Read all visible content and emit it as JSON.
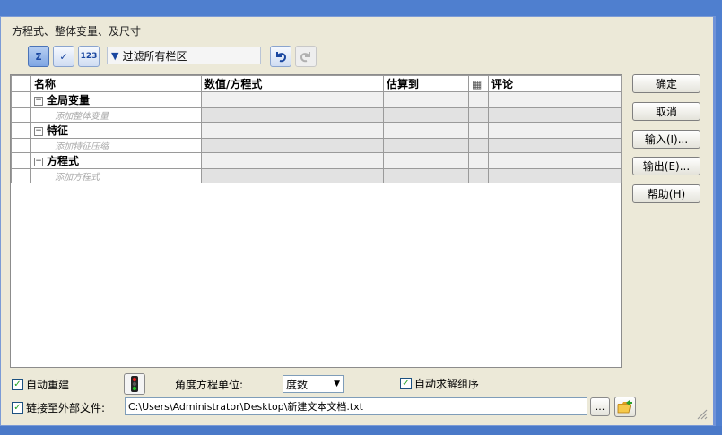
{
  "window": {
    "title": "方程式、整体变量、及尺寸"
  },
  "toolbar": {
    "filter_text": "过滤所有栏区",
    "buttons": [
      {
        "icon": "sigma-filter-icon",
        "state": "active"
      },
      {
        "icon": "check-filter-icon"
      },
      {
        "icon": "number-filter-icon",
        "label": "123"
      }
    ]
  },
  "grid": {
    "headers": {
      "name": "名称",
      "value": "数值/方程式",
      "evaluates": "估算到",
      "comment": "评论"
    },
    "groups": [
      {
        "label": "全局变量",
        "add_placeholder": "添加整体变量"
      },
      {
        "label": "特征",
        "add_placeholder": "添加特征压缩"
      },
      {
        "label": "方程式",
        "add_placeholder": "添加方程式"
      }
    ]
  },
  "buttons": {
    "ok": "确定",
    "cancel": "取消",
    "import": "输入(I)...",
    "export": "输出(E)...",
    "help": "帮助(H)"
  },
  "options": {
    "auto_rebuild": {
      "label": "自动重建",
      "checked": true
    },
    "angle_unit_label": "角度方程单位:",
    "angle_unit_value": "度数",
    "auto_solve": {
      "label": "自动求解组序",
      "checked": true
    },
    "link_external": {
      "label": "链接至外部文件:",
      "checked": true
    },
    "file_path": "C:\\Users\\Administrator\\Desktop\\新建文本文档.txt",
    "browse_label": "..."
  },
  "colors": {
    "accent": "#1a47a0",
    "window_bg": "#ece9d8",
    "desktop": "#4f7fcf"
  }
}
